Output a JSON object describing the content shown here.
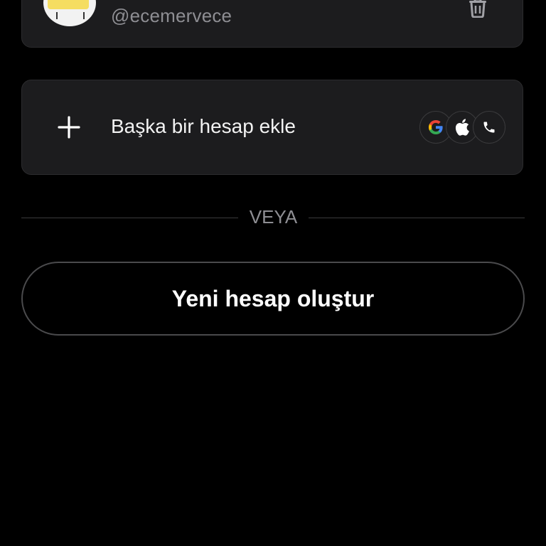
{
  "account": {
    "handle": "@ecemervece",
    "avatar_icon": "sticky-note-face-avatar",
    "remove_icon": "trash-icon"
  },
  "add_account": {
    "label": "Başka bir hesap ekle",
    "plus_icon": "plus-icon",
    "providers": [
      "google-icon",
      "apple-icon",
      "phone-icon"
    ]
  },
  "divider": {
    "label": "VEYA"
  },
  "create_account": {
    "label": "Yeni hesap oluştur"
  },
  "colors": {
    "background": "#000000",
    "card": "#1c1c1e",
    "secondary_text": "#8e8e93"
  }
}
